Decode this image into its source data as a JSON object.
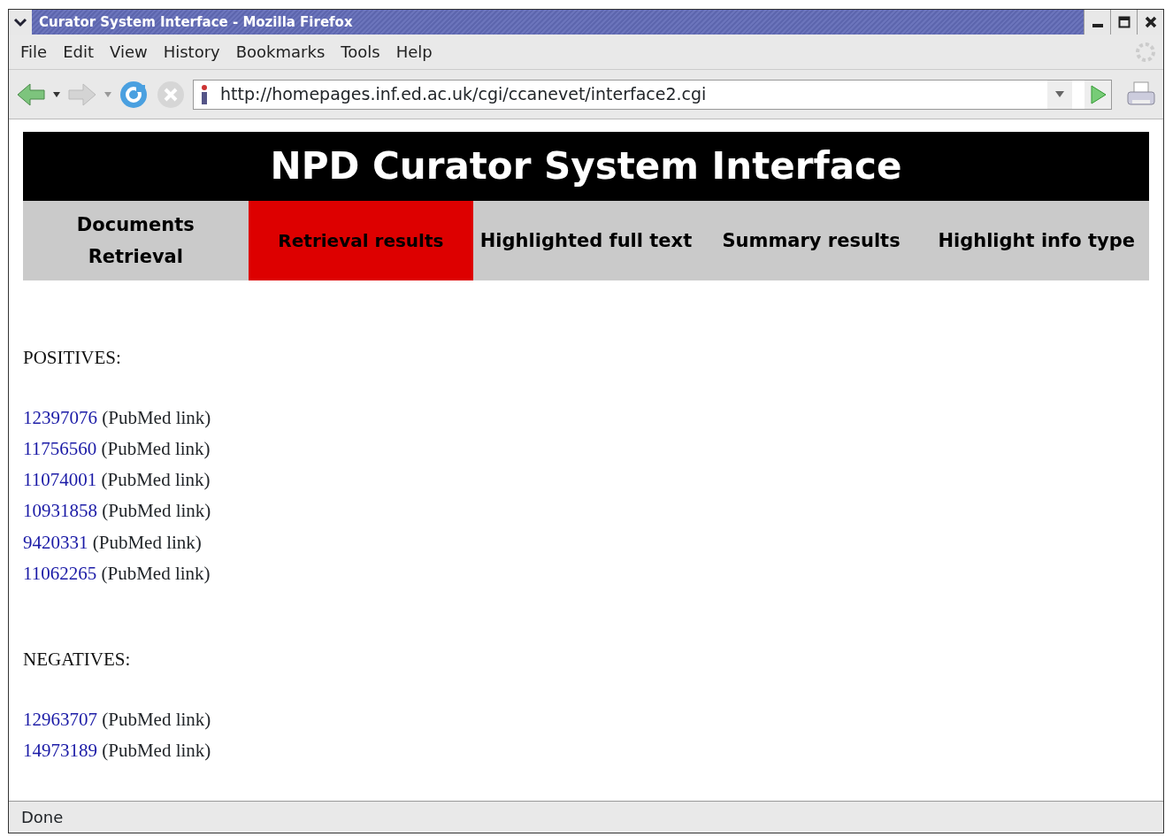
{
  "window": {
    "title": "Curator System Interface - Mozilla Firefox"
  },
  "menu": [
    "File",
    "Edit",
    "View",
    "History",
    "Bookmarks",
    "Tools",
    "Help"
  ],
  "address_bar": {
    "value": "http://homepages.inf.ed.ac.uk/cgi/ccanevet/interface2.cgi"
  },
  "page": {
    "heading": "NPD Curator System Interface",
    "tabs": [
      {
        "label": "Documents Retrieval",
        "selected": false
      },
      {
        "label": "Retrieval results",
        "selected": true
      },
      {
        "label": "Highlighted full text",
        "selected": false
      },
      {
        "label": "Summary results",
        "selected": false
      },
      {
        "label": "Highlight info type",
        "selected": false
      }
    ],
    "sections": [
      {
        "title": "POSITIVES:",
        "results": [
          {
            "id": "12397076",
            "note": "(PubMed link)"
          },
          {
            "id": "11756560",
            "note": "(PubMed link)"
          },
          {
            "id": "11074001",
            "note": "(PubMed link)"
          },
          {
            "id": "10931858",
            "note": "(PubMed link)"
          },
          {
            "id": "9420331",
            "note": "(PubMed link)"
          },
          {
            "id": "11062265",
            "note": "(PubMed link)"
          }
        ]
      },
      {
        "title": "NEGATIVES:",
        "results": [
          {
            "id": "12963707",
            "note": "(PubMed link)"
          },
          {
            "id": "14973189",
            "note": "(PubMed link)"
          }
        ]
      }
    ]
  },
  "status_bar": "Done"
}
